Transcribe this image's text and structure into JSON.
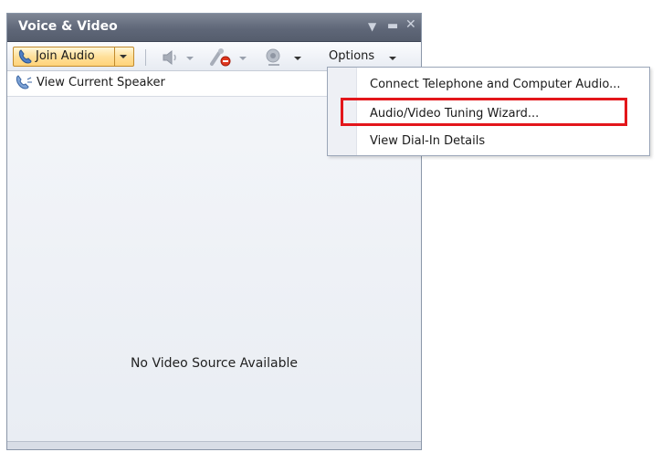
{
  "panel": {
    "title": "Voice & Video"
  },
  "toolbar": {
    "join_audio_label": "Join Audio",
    "options_label": "Options"
  },
  "speaker": {
    "label": "View Current Speaker"
  },
  "video": {
    "status": "No Video Source Available"
  },
  "options_menu": {
    "items": [
      {
        "label": "Connect Telephone and Computer Audio..."
      },
      {
        "label": "Audio/Video Tuning Wizard..."
      },
      {
        "label": "View Dial-In Details"
      }
    ],
    "highlight_color": "#e3161b"
  },
  "icons": [
    "phone-icon",
    "speaker-volume-icon",
    "mute-microphone-icon",
    "webcam-icon",
    "chevron-down-icon"
  ]
}
